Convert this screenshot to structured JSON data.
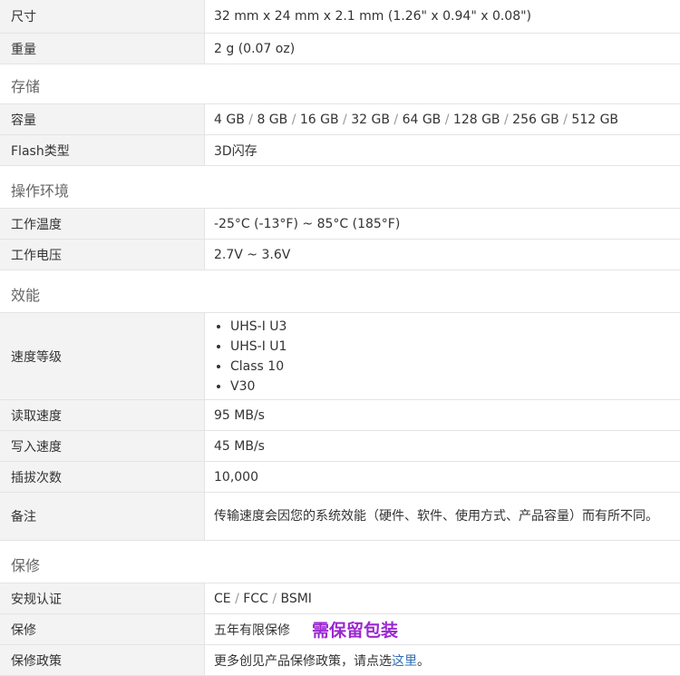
{
  "physical": {
    "size_label": "尺寸",
    "size_value": "32 mm x 24 mm x 2.1 mm (1.26\" x 0.94\" x 0.08\")",
    "weight_label": "重量",
    "weight_value": "2 g (0.07 oz)"
  },
  "storage": {
    "section_title": "存储",
    "capacity_label": "容量",
    "capacity_values": [
      "4 GB",
      "8 GB",
      "16 GB",
      "32 GB",
      "64 GB",
      "128 GB",
      "256 GB",
      "512 GB"
    ],
    "flash_label": "Flash类型",
    "flash_value": "3D闪存"
  },
  "environment": {
    "section_title": "操作环境",
    "temp_label": "工作温度",
    "temp_value": "-25°C (-13°F) ~ 85°C (185°F)",
    "voltage_label": "工作电压",
    "voltage_value": "2.7V ~ 3.6V"
  },
  "performance": {
    "section_title": "效能",
    "speed_class_label": "速度等级",
    "speed_classes": [
      "UHS-I U3",
      "UHS-I U1",
      "Class 10",
      "V30"
    ],
    "read_label": "读取速度",
    "read_value": "95 MB/s",
    "write_label": "写入速度",
    "write_value": "45 MB/s",
    "cycles_label": "插拔次数",
    "cycles_value": "10,000",
    "remark_label": "备注",
    "remark_value": "传输速度会因您的系统效能（硬件、软件、使用方式、产品容量）而有所不同。"
  },
  "warranty": {
    "section_title": "保修",
    "cert_label": "安规认证",
    "cert_values": [
      "CE",
      "FCC",
      "BSMI"
    ],
    "warranty_label": "保修",
    "warranty_value": "五年有限保修",
    "warranty_note": "需保留包装",
    "policy_label": "保修政策",
    "policy_prefix": "更多创见产品保修政策，请点选",
    "policy_link": "这里",
    "policy_suffix": "。"
  },
  "colors": {
    "label_bg": "#f3f3f3",
    "note_color": "#9b27d2",
    "link_color": "#2f6db3"
  }
}
